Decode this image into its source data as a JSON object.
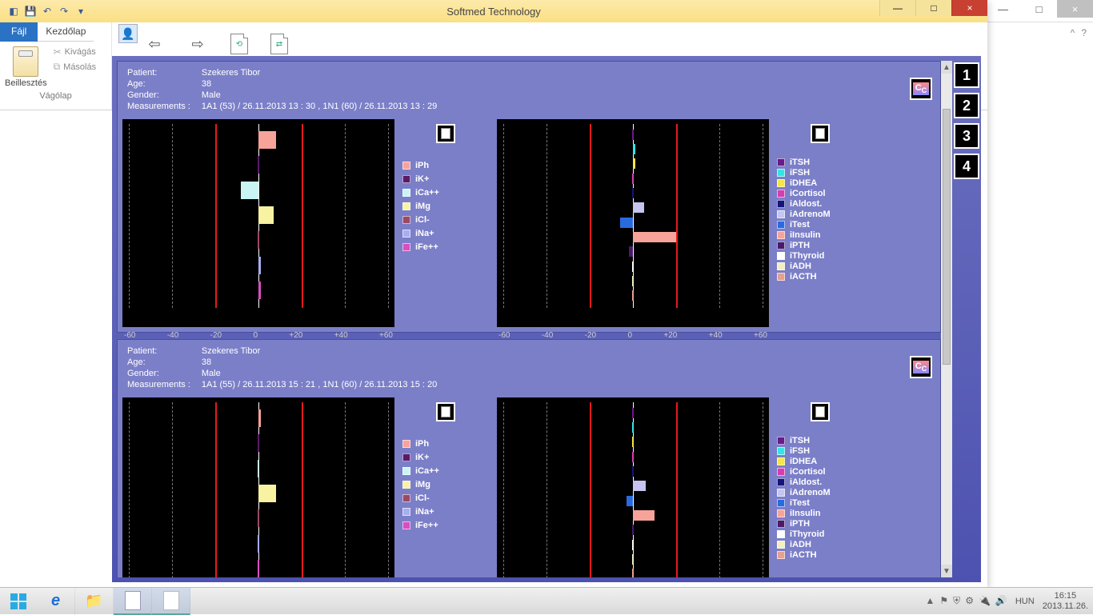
{
  "outer_window": {
    "min": "—",
    "max": "□",
    "close": "×",
    "chev_up": "^",
    "chev_q": "?",
    "zoom_minus": "−",
    "zoom_plus": "+"
  },
  "app": {
    "title": "Softmed Technology",
    "qat": {
      "save": "💾",
      "undo": "↶",
      "redo": "↷",
      "menu": "▾"
    },
    "winctrl": {
      "min": "—",
      "max": "□",
      "close": "×"
    },
    "ribbon": {
      "tab_file": "Fájl",
      "tab_home": "Kezdőlap",
      "paste": "Beillesztés",
      "cut": "Kivágás",
      "copy": "Másolás",
      "group": "Vágólap"
    },
    "toolbar": {
      "back": "⇦",
      "fwd": "⇨"
    }
  },
  "side_nums": [
    "1",
    "2",
    "3",
    "4"
  ],
  "patient_labels": {
    "patient": "Patient:",
    "age": "Age:",
    "gender": "Gender:",
    "meas": "Measurements :"
  },
  "records": [
    {
      "patient": "Szekeres Tibor",
      "age": "38",
      "gender": "Male",
      "meas": "1A1  (53)  / 26.11.2013  13 : 30 , 1N1  (60) / 26.11.2013  13 : 29"
    },
    {
      "patient": "Szekeres Tibor",
      "age": "38",
      "gender": "Male",
      "meas": "1A1  (55)  / 26.11.2013  15 : 21 , 1N1  (60) / 26.11.2013  15 : 20"
    }
  ],
  "axis": {
    "m60": "-60",
    "m40": "-40",
    "m20": "-20",
    "z": "0",
    "p20": "+20",
    "p40": "+40",
    "p60": "+60"
  },
  "legend_ions": [
    {
      "label": "iPh",
      "color": "#f7a39a"
    },
    {
      "label": "iK+",
      "color": "#5a1a6a"
    },
    {
      "label": "iCa++",
      "color": "#c9f4f4"
    },
    {
      "label": "iMg",
      "color": "#f7f3a3"
    },
    {
      "label": "iCl-",
      "color": "#9a4a65"
    },
    {
      "label": "iNa+",
      "color": "#a9aef0"
    },
    {
      "label": "iFe++",
      "color": "#d94fc1"
    }
  ],
  "legend_horm": [
    {
      "label": "iTSH",
      "color": "#6a1a8a"
    },
    {
      "label": "iFSH",
      "color": "#35e5e5"
    },
    {
      "label": "iDHEA",
      "color": "#f5e642"
    },
    {
      "label": "iCortisol",
      "color": "#d53db0"
    },
    {
      "label": "iAldost.",
      "color": "#14147a"
    },
    {
      "label": "iAdrenoM",
      "color": "#c5c5f0"
    },
    {
      "label": "iTest",
      "color": "#2a6adf"
    },
    {
      "label": "iInsulin",
      "color": "#f7a39a"
    },
    {
      "label": "iPTH",
      "color": "#4a1a6a"
    },
    {
      "label": "iThyroid",
      "color": "#ffffff"
    },
    {
      "label": "iADH",
      "color": "#f0f0c0"
    },
    {
      "label": "iACTH",
      "color": "#e8a090"
    }
  ],
  "chart_data": [
    {
      "record": 0,
      "panel": "ions",
      "type": "bar",
      "xlim": [
        -60,
        60
      ],
      "xticks": [
        -60,
        -40,
        -20,
        0,
        20,
        40,
        60
      ],
      "series": [
        {
          "name": "iPh",
          "value": 8,
          "color": "#f7a39a"
        },
        {
          "name": "iK+",
          "value": 0,
          "color": "#5a1a6a"
        },
        {
          "name": "iCa++",
          "value": -8,
          "color": "#c9f4f4"
        },
        {
          "name": "iMg",
          "value": 7,
          "color": "#f7f3a3"
        },
        {
          "name": "iCl-",
          "value": 0,
          "color": "#9a4a65"
        },
        {
          "name": "iNa+",
          "value": 1,
          "color": "#a9aef0"
        },
        {
          "name": "iFe++",
          "value": 1,
          "color": "#d94fc1"
        }
      ],
      "ref_lines": [
        -20,
        20
      ]
    },
    {
      "record": 0,
      "panel": "hormones",
      "type": "bar",
      "xlim": [
        -60,
        60
      ],
      "xticks": [
        -60,
        -40,
        -20,
        0,
        20,
        40,
        60
      ],
      "series": [
        {
          "name": "iTSH",
          "value": 0,
          "color": "#6a1a8a"
        },
        {
          "name": "iFSH",
          "value": 1,
          "color": "#35e5e5"
        },
        {
          "name": "iDHEA",
          "value": 1,
          "color": "#f5e642"
        },
        {
          "name": "iCortisol",
          "value": 0,
          "color": "#d53db0"
        },
        {
          "name": "iAldost.",
          "value": 0,
          "color": "#14147a"
        },
        {
          "name": "iAdrenoM",
          "value": 5,
          "color": "#c5c5f0"
        },
        {
          "name": "iTest",
          "value": -6,
          "color": "#2a6adf"
        },
        {
          "name": "iInsulin",
          "value": 20,
          "color": "#f7a39a"
        },
        {
          "name": "iPTH",
          "value": -2,
          "color": "#4a1a6a"
        },
        {
          "name": "iThyroid",
          "value": 0,
          "color": "#ffffff"
        },
        {
          "name": "iADH",
          "value": 0,
          "color": "#f0f0c0"
        },
        {
          "name": "iACTH",
          "value": 0,
          "color": "#e8a090"
        }
      ],
      "ref_lines": [
        -20,
        20
      ]
    },
    {
      "record": 1,
      "panel": "ions",
      "type": "bar",
      "xlim": [
        -60,
        60
      ],
      "xticks": [
        -60,
        -40,
        -20,
        0,
        20,
        40,
        60
      ],
      "series": [
        {
          "name": "iPh",
          "value": 1,
          "color": "#f7a39a"
        },
        {
          "name": "iK+",
          "value": 0,
          "color": "#5a1a6a"
        },
        {
          "name": "iCa++",
          "value": 0,
          "color": "#c9f4f4"
        },
        {
          "name": "iMg",
          "value": 8,
          "color": "#f7f3a3"
        },
        {
          "name": "iCl-",
          "value": 0,
          "color": "#9a4a65"
        },
        {
          "name": "iNa+",
          "value": 0,
          "color": "#a9aef0"
        },
        {
          "name": "iFe++",
          "value": 0,
          "color": "#d94fc1"
        }
      ],
      "ref_lines": [
        -20,
        20
      ]
    },
    {
      "record": 1,
      "panel": "hormones",
      "type": "bar",
      "xlim": [
        -60,
        60
      ],
      "xticks": [
        -60,
        -40,
        -20,
        0,
        20,
        40,
        60
      ],
      "series": [
        {
          "name": "iTSH",
          "value": 0,
          "color": "#6a1a8a"
        },
        {
          "name": "iFSH",
          "value": 0,
          "color": "#35e5e5"
        },
        {
          "name": "iDHEA",
          "value": 0,
          "color": "#f5e642"
        },
        {
          "name": "iCortisol",
          "value": 0,
          "color": "#d53db0"
        },
        {
          "name": "iAldost.",
          "value": 0,
          "color": "#14147a"
        },
        {
          "name": "iAdrenoM",
          "value": 6,
          "color": "#c5c5f0"
        },
        {
          "name": "iTest",
          "value": -3,
          "color": "#2a6adf"
        },
        {
          "name": "iInsulin",
          "value": 10,
          "color": "#f7a39a"
        },
        {
          "name": "iPTH",
          "value": 0,
          "color": "#4a1a6a"
        },
        {
          "name": "iThyroid",
          "value": 0,
          "color": "#ffffff"
        },
        {
          "name": "iADH",
          "value": 0,
          "color": "#f0f0c0"
        },
        {
          "name": "iACTH",
          "value": 0,
          "color": "#e8a090"
        }
      ],
      "ref_lines": [
        -20,
        20
      ]
    }
  ],
  "taskbar": {
    "lang": "HUN",
    "time": "16:15",
    "date": "2013.11.26."
  }
}
